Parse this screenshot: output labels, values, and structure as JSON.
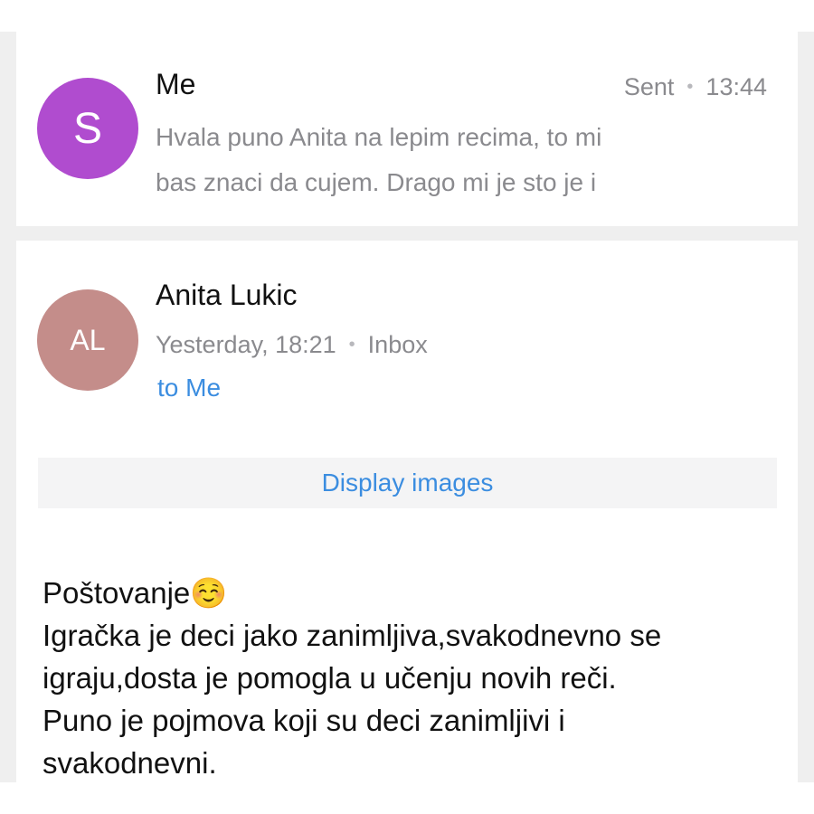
{
  "thread": {
    "sent_message": {
      "avatar_letter": "S",
      "sender": "Me",
      "folder": "Sent",
      "time": "13:44",
      "preview_lines": [
        "Hvala puno Anita na lepim recima, to mi",
        "bas znaci da cujem. Drago mi je sto je i"
      ]
    },
    "received_message": {
      "avatar_initials": "AL",
      "sender": "Anita Lukic",
      "date": "Yesterday, 18:21",
      "folder": "Inbox",
      "recipient": "to Me",
      "display_images_label": "Display images",
      "body_lines": [
        "Poštovanje☺️",
        "Igračka je deci jako zanimljiva,svakodnevno se",
        "igraju,dosta je pomogla u učenju novih reči.",
        "Puno je pojmova koji su deci zanimljivi i",
        "svakodnevni."
      ]
    }
  },
  "colors": {
    "avatar_s": "#b04ccf",
    "avatar_al": "#c48d8a",
    "link_blue": "#3b8de0",
    "meta_gray": "#8a8a8e"
  },
  "icons": {
    "separator_dot": "•"
  }
}
